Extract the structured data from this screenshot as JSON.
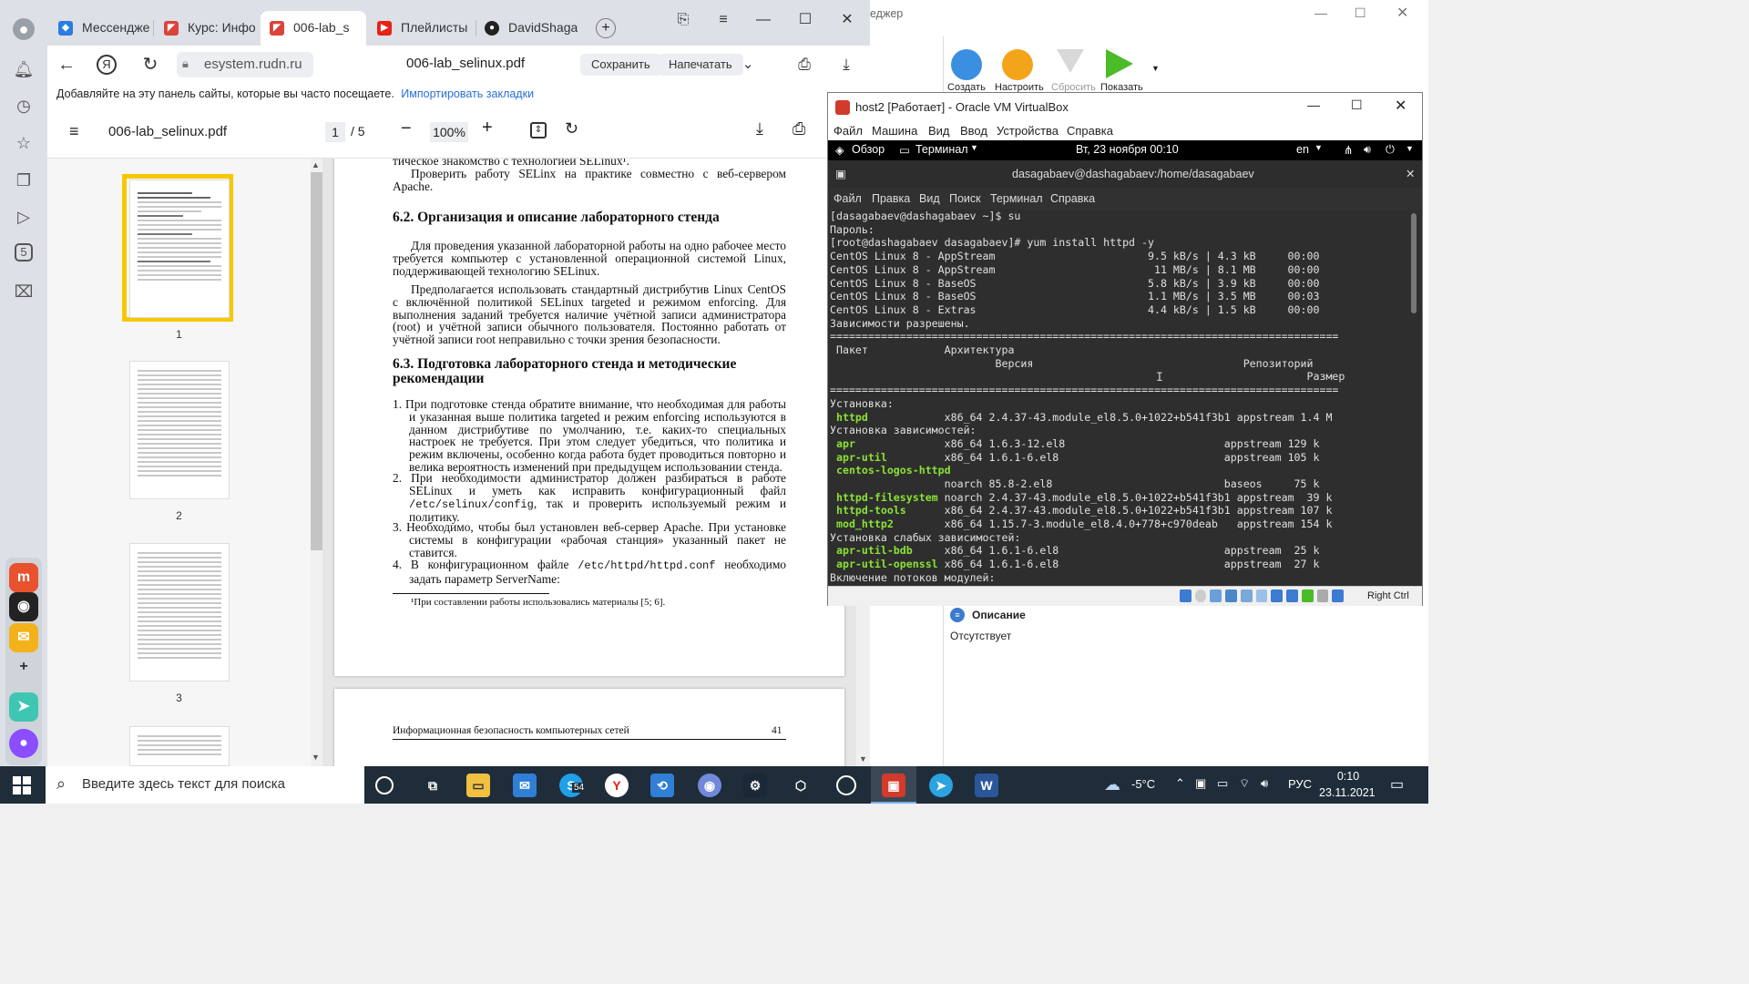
{
  "browser": {
    "tabs": [
      {
        "label": "Мессендже",
        "icon": "messenger-icon"
      },
      {
        "label": "Курс: Инфо",
        "icon": "course-icon"
      },
      {
        "label": "006-lab_s",
        "icon": "pdf-tab-icon"
      },
      {
        "label": "Плейлисты",
        "icon": "youtube-icon"
      },
      {
        "label": "DavidShaga",
        "icon": "github-icon"
      }
    ],
    "address": "esystem.rudn.ru",
    "page_title": "006-lab_selinux.pdf",
    "save_label": "Сохранить",
    "print_label": "Напечатать",
    "bookmarks_hint": "Добавляйте на эту панель сайты, которые вы часто посещаете.",
    "import_bookmarks": "Импортировать закладки"
  },
  "pdf": {
    "filename": "006-lab_selinux.pdf",
    "current_page": "1",
    "total_pages": "/ 5",
    "zoom": "100%",
    "thumbnails": [
      "1",
      "2",
      "3"
    ],
    "page1": {
      "top_line": "тическое знакомство с технологией SELinux¹.",
      "para0": "Проверить работу SELinx на практике совместно с веб-сервером Apache.",
      "h62": "6.2.   Организация и описание лабораторного стенда",
      "para1": "Для проведения указанной лабораторной работы на одно рабочее место требуется компьютер с установленной операционной системой Linux, поддерживающей технологию SELinux.",
      "para2": "Предполагается использовать стандартный дистрибутив Linux CentOS с включённой политикой SELinux targeted и режимом enforcing. Для выполнения заданий требуется наличие учётной записи администратора (root) и учётной записи обычного пользователя. Постоянно работать от учётной записи root неправильно с точки зрения безопасности.",
      "h63": "6.3.   Подготовка лабораторного стенда и методические рекомендации",
      "item1": "1.  При подготовке стенда обратите внимание, что необходимая для работы и указанная выше политика targeted и режим enforcing используются в данном дистрибутиве по умолчанию, т.е. каких-то специальных настроек не требуется. При этом следует убедиться, что политика и режим включены, особенно когда работа будет проводиться повторно и велика вероятность изменений при предыдущем использовании стенда.",
      "item2a": "2.  При необходимости администратор должен разбираться в работе SELinux и уметь как исправить конфигурационный файл",
      "item2path": "/etc/selinux/config",
      "item2b": ", так и проверить используемый режим и политику.",
      "item3": "3.  Необходимо, чтобы был установлен веб-сервер Apache. При установке системы в конфигурации «рабочая станция» указанный пакет не ставится.",
      "item4a": "4.  В конфигурационном файле",
      "item4path": "/etc/httpd/httpd.conf",
      "item4b": "необходимо задать параметр ServerName:",
      "footnote": "¹При составлении работы использовались материалы [5; 6]."
    },
    "page2": {
      "footer_left": "Информационная безопасность компьютерных сетей",
      "footer_right": "41"
    }
  },
  "bgapp": {
    "title_fragment": "еджер",
    "toolbar": [
      {
        "label": "Создать",
        "icon": "create-icon"
      },
      {
        "label": "Настроить",
        "icon": "settings-gear-icon"
      },
      {
        "label": "Сбросить",
        "icon": "discard-arrow-icon"
      },
      {
        "label": "Показать",
        "icon": "show-arrow-icon"
      }
    ],
    "description_label": "Описание",
    "description_value": "Отсутствует"
  },
  "vbox": {
    "title": "host2 [Работает] - Oracle VM VirtualBox",
    "menu": [
      "Файл",
      "Машина",
      "Вид",
      "Ввод",
      "Устройства",
      "Справка"
    ],
    "host_key": "Right Ctrl"
  },
  "gnome": {
    "overview": "Обзор",
    "app": "Терминал",
    "clock": "Вт, 23 ноября  00:10",
    "lang": "en"
  },
  "terminal": {
    "title": "dasagabaev@dashagabaev:/home/dasagabaev",
    "menu": [
      "Файл",
      "Правка",
      "Вид",
      "Поиск",
      "Терминал",
      "Справка"
    ],
    "lines_pre": [
      "[dasagabaev@dashagabaev ~]$ su",
      "Пароль:",
      "[root@dashagabaev dasagabaev]# yum install httpd -y",
      "CentOS Linux 8 - AppStream                        9.5 kB/s | 4.3 kB     00:00",
      "CentOS Linux 8 - AppStream                         11 MB/s | 8.1 MB     00:00",
      "CentOS Linux 8 - BaseOS                           5.8 kB/s | 3.9 kB     00:00",
      "CentOS Linux 8 - BaseOS                           1.1 MB/s | 3.5 MB     00:03",
      "CentOS Linux 8 - Extras                           4.4 kB/s | 1.5 kB     00:00",
      "Зависимости разрешены.",
      "================================================================================",
      " Пакет            Архитектура",
      "                          Версия                                 Репозиторий",
      "                                                                           Размер",
      "================================================================================",
      "Установка:"
    ],
    "packages": [
      {
        "name": " httpd",
        "rest": "            x86_64 2.4.37-43.module_el8.5.0+1022+b541f3b1 appstream 1.4 M",
        "green": true
      },
      {
        "name": "Установка зависимостей:",
        "rest": "",
        "green": false
      },
      {
        "name": " apr",
        "rest": "              x86_64 1.6.3-12.el8                         appstream 129 k",
        "green": true
      },
      {
        "name": " apr-util",
        "rest": "         x86_64 1.6.1-6.el8                          appstream 105 k",
        "green": true
      },
      {
        "name": " centos-logos-httpd",
        "rest": "",
        "green": true
      },
      {
        "name": "",
        "rest": "                  noarch 85.8-2.el8                           baseos     75 k",
        "green": false
      },
      {
        "name": " httpd-filesystem",
        "rest": " noarch 2.4.37-43.module_el8.5.0+1022+b541f3b1 appstream  39 k",
        "green": true
      },
      {
        "name": " httpd-tools",
        "rest": "      x86_64 2.4.37-43.module_el8.5.0+1022+b541f3b1 appstream 107 k",
        "green": true
      },
      {
        "name": " mod_http2",
        "rest": "        x86_64 1.15.7-3.module_el8.4.0+778+c970deab   appstream 154 k",
        "green": true
      },
      {
        "name": "Установка слабых зависимостей:",
        "rest": "",
        "green": false
      },
      {
        "name": " apr-util-bdb",
        "rest": "     x86_64 1.6.1-6.el8                          appstream  25 k",
        "green": true
      },
      {
        "name": " apr-util-openssl",
        "rest": " x86_64 1.6.1-6.el8                          appstream  27 k",
        "green": true
      },
      {
        "name": "Включение потоков модулей:",
        "rest": "",
        "green": false
      }
    ]
  },
  "taskbar": {
    "search_placeholder": "Введите здесь текст для поиска",
    "skype_badge": "54",
    "weather": "-5°C",
    "lang": "РУС",
    "time": "0:10",
    "date": "23.11.2021"
  }
}
